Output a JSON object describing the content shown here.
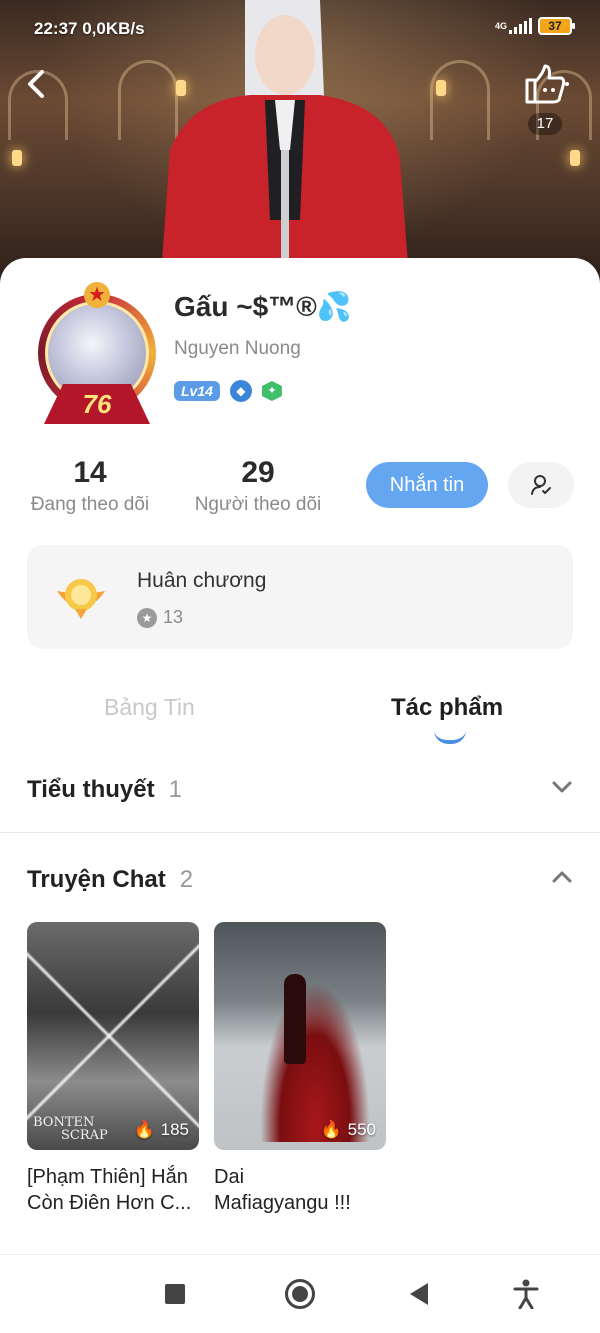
{
  "status_bar": {
    "time": "22:37",
    "network_speed": "0,0KB/s",
    "network_type": "4G",
    "battery": "37",
    "icons": [
      "signal-icon",
      "battery-icon"
    ]
  },
  "header": {
    "back_icon": "chevron-left-icon",
    "like_icon": "thumbs-up-icon",
    "like_count": "17"
  },
  "profile": {
    "display_name": "Gấu ~$™®",
    "name_emoji": "💦",
    "username": "Nguyen Nuong",
    "avatar_level": "76",
    "level_badge": "Lv14",
    "badges": [
      "diamond-badge-icon",
      "leaf-badge-icon"
    ]
  },
  "stats": {
    "following_count": "14",
    "following_label": "Đang theo dõi",
    "followers_count": "29",
    "followers_label": "Người theo dõi"
  },
  "actions": {
    "message_label": "Nhắn tin",
    "follow_icon": "user-follow-icon"
  },
  "medals": {
    "title": "Huân chương",
    "count": "13",
    "icon": "medal-icon"
  },
  "tabs": {
    "news": "Bảng Tin",
    "works": "Tác phẩm",
    "active": "works"
  },
  "sections": {
    "novels": {
      "title": "Tiểu thuyết",
      "count": "1",
      "expanded": false
    },
    "chat_stories": {
      "title": "Truyện Chat",
      "count": "2",
      "expanded": true
    }
  },
  "books": [
    {
      "title_line1": "[Phạm Thiên] Hắn",
      "title_line2": "Còn Điên Hơn C...",
      "views": "185",
      "cover_caption_1": "BONTEN",
      "cover_caption_2": "SCRAP"
    },
    {
      "title_line1": "Dai",
      "title_line2": "Mafiagyangu !!!",
      "views": "550"
    }
  ],
  "nav_bar": {
    "icons": [
      "recent-apps-icon",
      "home-icon",
      "back-icon",
      "accessibility-icon"
    ]
  },
  "colors": {
    "accent": "#64a6f0",
    "tab_indicator": "#4a90e2",
    "level_badge": "#5b9be8",
    "avatar_frame": "#b3152b"
  }
}
